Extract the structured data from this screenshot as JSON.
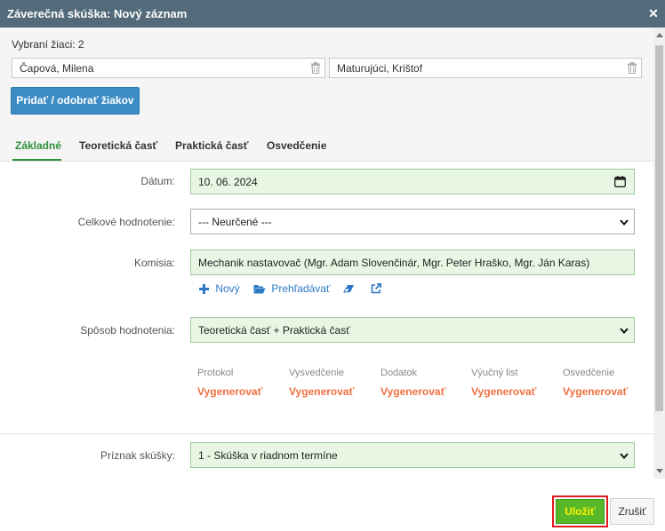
{
  "window": {
    "title": "Záverečná skúška: Nový záznam",
    "close_icon": "close-icon"
  },
  "header": {
    "selected_label": "Vybraní žiaci: 2",
    "students": [
      "Čapová, Milena",
      "Maturujúci, Krištof"
    ],
    "add_button": "Pridať / odobrať žiakov"
  },
  "tabs": [
    "Základné",
    "Teoretická časť",
    "Praktická časť",
    "Osvedčenie"
  ],
  "form": {
    "date_label": "Dátum:",
    "date_value": "10. 06. 2024",
    "rating_label": "Celkové hodnotenie:",
    "rating_value": "--- Neurčené ---",
    "committee_label": "Komisia:",
    "committee_value": "Mechanik nastavovač (Mgr.  Adam Slovenčinár, Mgr.  Peter Hraško, Mgr.  Ján Karas)",
    "actions": {
      "new": "Nový",
      "browse": "Prehľadávať"
    },
    "method_label": "Spôsob hodnotenia:",
    "method_value": "Teoretická časť + Praktická časť",
    "flag_label": "Príznak skúšky:",
    "flag_value": "1 - Skúška v riadnom termíne"
  },
  "documents": [
    {
      "label": "Protokol",
      "link": "Vygenerovať"
    },
    {
      "label": "Vysvedčenie",
      "link": "Vygenerovať"
    },
    {
      "label": "Dodatok",
      "link": "Vygenerovať"
    },
    {
      "label": "Výučný list",
      "link": "Vygenerovať"
    },
    {
      "label": "Osvedčenie",
      "link": "Vygenerovať"
    }
  ],
  "footer": {
    "save": "Uložiť",
    "cancel": "Zrušiť"
  },
  "colors": {
    "titlebar": "#526a7a",
    "active_tab": "#2f8f3a",
    "link": "#2c78c4",
    "generate": "#f07040",
    "save_bg": "#57b829",
    "highlight": "#e41b1b"
  }
}
